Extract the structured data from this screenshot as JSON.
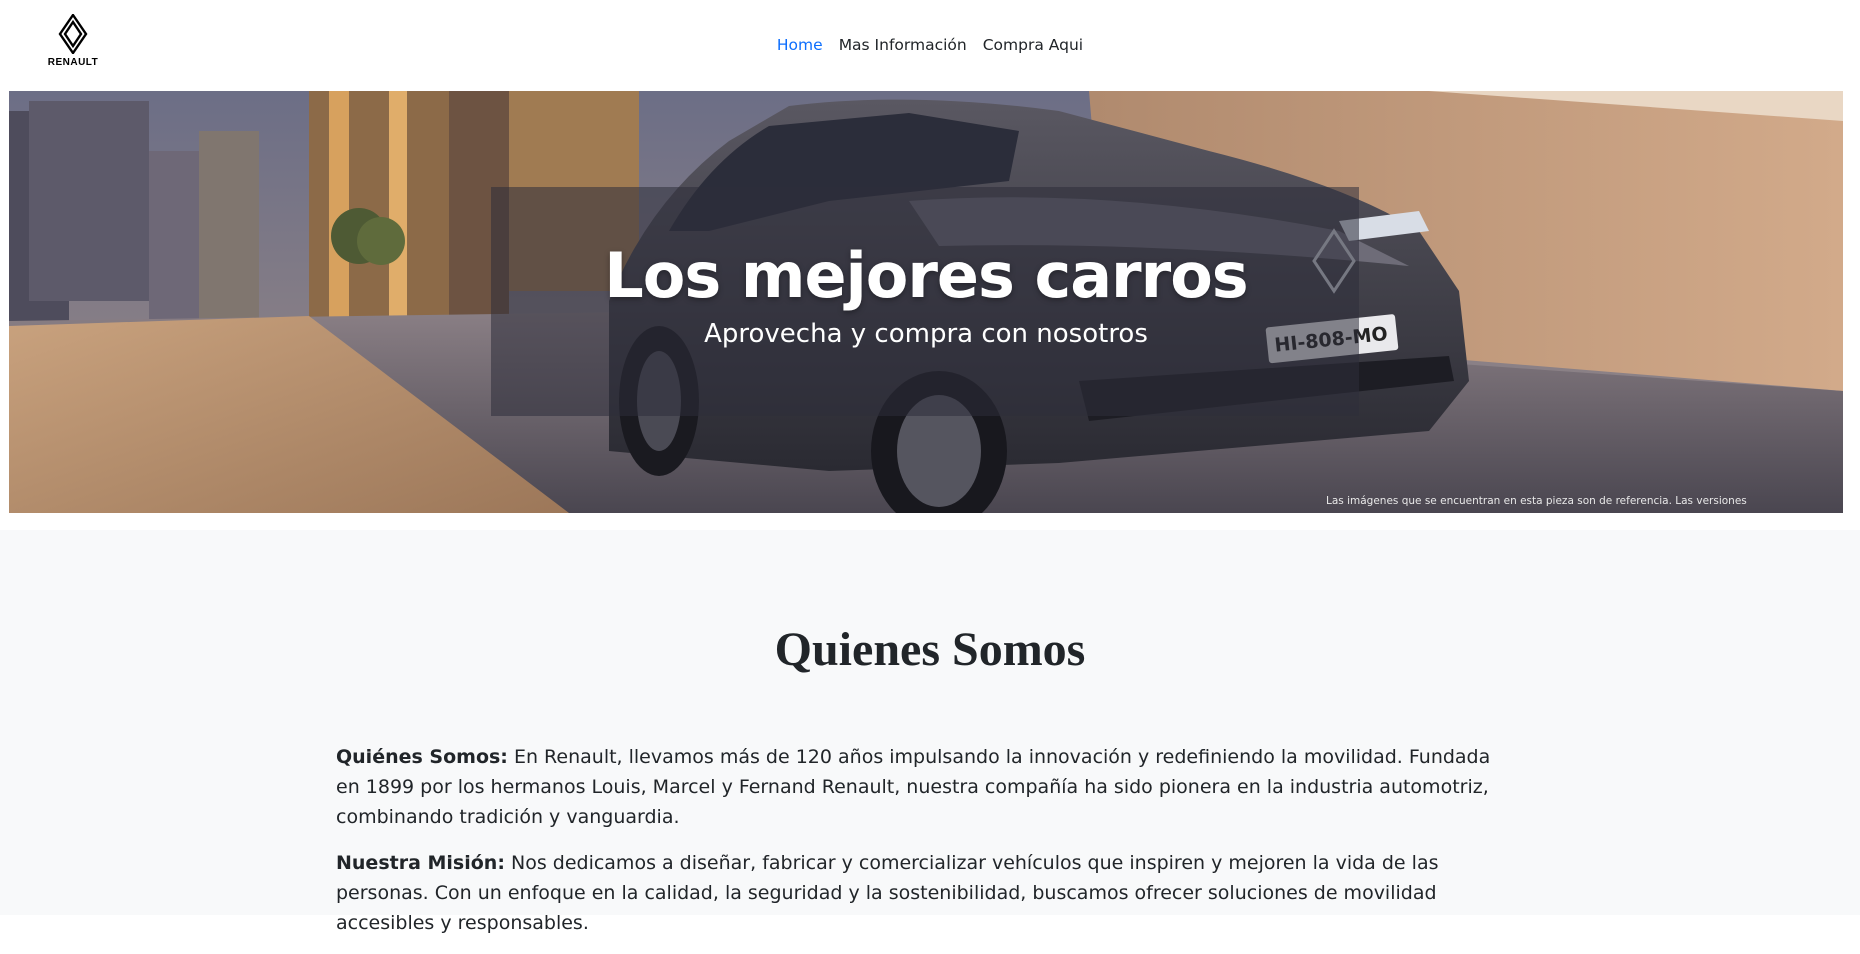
{
  "brand": {
    "name": "RENAULT"
  },
  "nav": {
    "links": [
      {
        "label": "Home",
        "active": true
      },
      {
        "label": "Mas Información",
        "active": false
      },
      {
        "label": "Compra Aqui",
        "active": false
      }
    ]
  },
  "hero": {
    "title": "Los mejores carros",
    "subtitle": "Aprovecha y compra con nosotros",
    "plate": "HI-808-MO",
    "disclaimer": "Las imágenes que se encuentran en esta pieza son de referencia. Las versiones"
  },
  "about": {
    "title": "Quienes Somos",
    "paragraphs": [
      {
        "label": "Quiénes Somos:",
        "text": " En Renault, llevamos más de 120 años impulsando la innovación y redefiniendo la movilidad. Fundada en 1899 por los hermanos Louis, Marcel y Fernand Renault, nuestra compañía ha sido pionera en la industria automotriz, combinando tradición y vanguardia."
      },
      {
        "label": "Nuestra Misión:",
        "text": " Nos dedicamos a diseñar, fabricar y comercializar vehículos que inspiren y mejoren la vida de las personas. Con un enfoque en la calidad, la seguridad y la sostenibilidad, buscamos ofrecer soluciones de movilidad accesibles y responsables."
      }
    ]
  },
  "colors": {
    "nav_active": "#0d6efd",
    "text": "#212529",
    "section_bg": "#f8f9fa"
  }
}
